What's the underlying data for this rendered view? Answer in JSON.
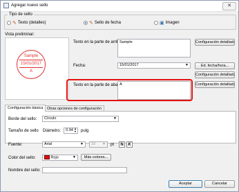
{
  "window": {
    "title": "Agregar nuevo sello",
    "close_glyph": "✕"
  },
  "stamp_type": {
    "group_label": "Tipo de sello",
    "options": [
      {
        "label": "Texto (detalles)",
        "icon": "text-stamp-icon",
        "selected": false
      },
      {
        "label": "Sello de fecha",
        "icon": "date-stamp-icon",
        "selected": true
      },
      {
        "label": "Imagen",
        "icon": "image-stamp-icon",
        "selected": false
      }
    ]
  },
  "preview": {
    "label": "Vista preliminar:",
    "top_text": "Sample",
    "date_text": "15/01/2017",
    "bottom_text": "A",
    "stamp_color": "#e03030"
  },
  "fields": {
    "top_label": "Texto en la parte de arriba:",
    "top_value": "Sample",
    "top_button": "Configuración detallada...",
    "date_label": "Fecha:",
    "date_value": "15/01/2017",
    "date_button": "Ed. fecha/hora...",
    "date_detail_button": "Configuración detallada...",
    "bottom_label": "Texto en la parte de abajo:",
    "bottom_value": "A",
    "bottom_button": "Configuración detallada..."
  },
  "tabs": {
    "basic": "Configuración básica",
    "other": "Otras opciones de configuración"
  },
  "basic": {
    "border_label": "Borde del sello:",
    "border_value": "Círculo",
    "size_label": "Tamaño de sello",
    "diameter_label": "Diámetro:",
    "diameter_value": "0.94",
    "diameter_unit": "pulg",
    "font_label": "Fuente:",
    "font_value": "Arial",
    "font_size_value": "10",
    "font_size_unit": "pt",
    "bold_glyph": "N",
    "italic_glyph": "K",
    "color_label": "Color del sello:",
    "color_value": "Rojo",
    "color_hex": "#e11111",
    "more_colors_button": "Más colores..."
  },
  "name": {
    "label": "Nombre del sello:",
    "value": ""
  },
  "footer": {
    "accept": "Aceptar",
    "cancel": "Cancelar"
  }
}
